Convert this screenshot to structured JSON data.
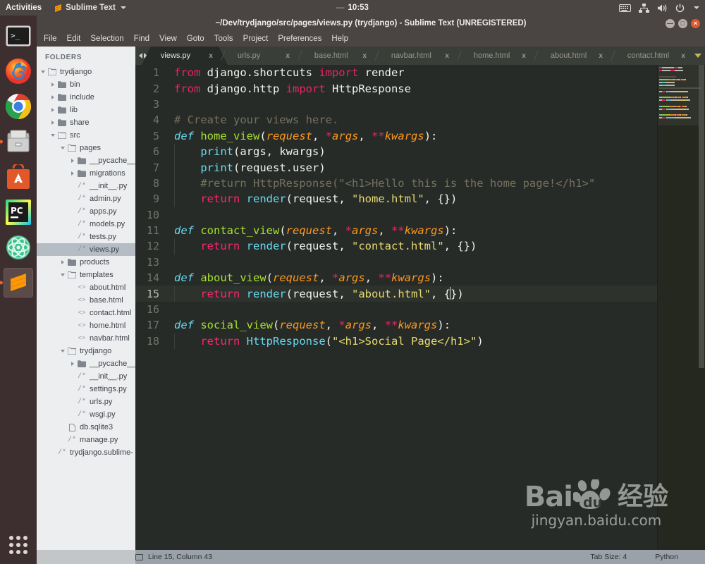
{
  "topbar": {
    "activities": "Activities",
    "app_name": "Sublime Text",
    "clock": "10:53",
    "clock_dash": "—",
    "icons": [
      "keyboard-icon",
      "network-icon",
      "volume-icon",
      "power-icon",
      "chevron-down-icon"
    ]
  },
  "launcher": {
    "items": [
      {
        "name": "terminal",
        "label": "Terminal",
        "active": false
      },
      {
        "name": "firefox",
        "label": "Firefox",
        "active": false
      },
      {
        "name": "chrome",
        "label": "Google Chrome",
        "active": false
      },
      {
        "name": "files",
        "label": "Files",
        "active": false,
        "running": true
      },
      {
        "name": "ubuntu-software",
        "label": "Ubuntu Software",
        "active": false
      },
      {
        "name": "pycharm",
        "label": "PyCharm",
        "active": false
      },
      {
        "name": "atom",
        "label": "Atom",
        "active": false
      },
      {
        "name": "sublime-text",
        "label": "Sublime Text",
        "active": true,
        "running": true
      }
    ],
    "app_grid": "show-applications"
  },
  "window": {
    "title": "~/Dev/trydjango/src/pages/views.py (trydjango) - Sublime Text (UNREGISTERED)",
    "buttons": {
      "minimize": "—",
      "maximize": "□",
      "close": "×"
    }
  },
  "menubar": {
    "items": [
      "File",
      "Edit",
      "Selection",
      "Find",
      "View",
      "Goto",
      "Tools",
      "Project",
      "Preferences",
      "Help"
    ]
  },
  "sidebar": {
    "title": "FOLDERS",
    "tree": [
      {
        "label": "trydjango",
        "depth": 0,
        "type": "folder-open",
        "twisty": "open",
        "selected": false
      },
      {
        "label": "bin",
        "depth": 1,
        "type": "folder",
        "twisty": "closed",
        "selected": false
      },
      {
        "label": "include",
        "depth": 1,
        "type": "folder",
        "twisty": "closed",
        "selected": false
      },
      {
        "label": "lib",
        "depth": 1,
        "type": "folder",
        "twisty": "closed",
        "selected": false
      },
      {
        "label": "share",
        "depth": 1,
        "type": "folder",
        "twisty": "closed",
        "selected": false
      },
      {
        "label": "src",
        "depth": 1,
        "type": "folder-open",
        "twisty": "open",
        "selected": false
      },
      {
        "label": "pages",
        "depth": 2,
        "type": "folder-open",
        "twisty": "open",
        "selected": false
      },
      {
        "label": "__pycache__",
        "depth": 3,
        "type": "folder",
        "twisty": "closed",
        "selected": false
      },
      {
        "label": "migrations",
        "depth": 3,
        "type": "folder",
        "twisty": "closed",
        "selected": false
      },
      {
        "label": "__init__.py",
        "depth": 3,
        "type": "py",
        "twisty": "none",
        "selected": false
      },
      {
        "label": "admin.py",
        "depth": 3,
        "type": "py",
        "twisty": "none",
        "selected": false
      },
      {
        "label": "apps.py",
        "depth": 3,
        "type": "py",
        "twisty": "none",
        "selected": false
      },
      {
        "label": "models.py",
        "depth": 3,
        "type": "py",
        "twisty": "none",
        "selected": false
      },
      {
        "label": "tests.py",
        "depth": 3,
        "type": "py",
        "twisty": "none",
        "selected": false
      },
      {
        "label": "views.py",
        "depth": 3,
        "type": "py",
        "twisty": "none",
        "selected": true
      },
      {
        "label": "products",
        "depth": 2,
        "type": "folder",
        "twisty": "closed",
        "selected": false
      },
      {
        "label": "templates",
        "depth": 2,
        "type": "folder-open",
        "twisty": "open",
        "selected": false
      },
      {
        "label": "about.html",
        "depth": 3,
        "type": "html",
        "twisty": "none",
        "selected": false
      },
      {
        "label": "base.html",
        "depth": 3,
        "type": "html",
        "twisty": "none",
        "selected": false
      },
      {
        "label": "contact.html",
        "depth": 3,
        "type": "html",
        "twisty": "none",
        "selected": false
      },
      {
        "label": "home.html",
        "depth": 3,
        "type": "html",
        "twisty": "none",
        "selected": false
      },
      {
        "label": "navbar.html",
        "depth": 3,
        "type": "html",
        "twisty": "none",
        "selected": false
      },
      {
        "label": "trydjango",
        "depth": 2,
        "type": "folder-open",
        "twisty": "open",
        "selected": false
      },
      {
        "label": "__pycache__",
        "depth": 3,
        "type": "folder",
        "twisty": "closed",
        "selected": false
      },
      {
        "label": "__init__.py",
        "depth": 3,
        "type": "py",
        "twisty": "none",
        "selected": false
      },
      {
        "label": "settings.py",
        "depth": 3,
        "type": "py",
        "twisty": "none",
        "selected": false
      },
      {
        "label": "urls.py",
        "depth": 3,
        "type": "py",
        "twisty": "none",
        "selected": false
      },
      {
        "label": "wsgi.py",
        "depth": 3,
        "type": "py",
        "twisty": "none",
        "selected": false
      },
      {
        "label": "db.sqlite3",
        "depth": 2,
        "type": "file",
        "twisty": "none",
        "selected": false
      },
      {
        "label": "manage.py",
        "depth": 2,
        "type": "py",
        "twisty": "none",
        "selected": false
      },
      {
        "label": "trydjango.sublime-",
        "depth": 1,
        "type": "py",
        "twisty": "none",
        "selected": false
      }
    ]
  },
  "tabs": {
    "close_glyph": "x",
    "items": [
      {
        "label": "views.py",
        "active": true
      },
      {
        "label": "urls.py",
        "active": false
      },
      {
        "label": "base.html",
        "active": false
      },
      {
        "label": "navbar.html",
        "active": false
      },
      {
        "label": "home.html",
        "active": false
      },
      {
        "label": "about.html",
        "active": false
      },
      {
        "label": "contact.html",
        "active": false
      }
    ]
  },
  "editor": {
    "language": "Python",
    "lines": [
      {
        "n": "1",
        "cur": false,
        "tokens": [
          {
            "t": "from",
            "c": "kw"
          },
          {
            "t": " django.shortcuts ",
            "c": "id"
          },
          {
            "t": "import",
            "c": "kw"
          },
          {
            "t": " render",
            "c": "id"
          }
        ]
      },
      {
        "n": "2",
        "cur": false,
        "tokens": [
          {
            "t": "from",
            "c": "kw"
          },
          {
            "t": " django.http ",
            "c": "id"
          },
          {
            "t": "import",
            "c": "kw"
          },
          {
            "t": " HttpResponse",
            "c": "id"
          }
        ]
      },
      {
        "n": "3",
        "cur": false,
        "tokens": []
      },
      {
        "n": "4",
        "cur": false,
        "tokens": [
          {
            "t": "# Create your views here.",
            "c": "cmt"
          }
        ]
      },
      {
        "n": "5",
        "cur": false,
        "tokens": [
          {
            "t": "def",
            "c": "defkw"
          },
          {
            "t": " ",
            "c": "id"
          },
          {
            "t": "home_view",
            "c": "fn"
          },
          {
            "t": "(",
            "c": "op"
          },
          {
            "t": "request",
            "c": "par"
          },
          {
            "t": ", ",
            "c": "op"
          },
          {
            "t": "*",
            "c": "kw"
          },
          {
            "t": "args",
            "c": "par"
          },
          {
            "t": ", ",
            "c": "op"
          },
          {
            "t": "**",
            "c": "kw"
          },
          {
            "t": "kwargs",
            "c": "par"
          },
          {
            "t": "):",
            "c": "op"
          }
        ]
      },
      {
        "n": "6",
        "cur": false,
        "tokens": [
          {
            "t": "    ",
            "c": "op"
          },
          {
            "t": "print",
            "c": "call"
          },
          {
            "t": "(args, kwargs)",
            "c": "id"
          }
        ]
      },
      {
        "n": "7",
        "cur": false,
        "tokens": [
          {
            "t": "    ",
            "c": "op"
          },
          {
            "t": "print",
            "c": "call"
          },
          {
            "t": "(request.user)",
            "c": "id"
          }
        ]
      },
      {
        "n": "8",
        "cur": false,
        "tokens": [
          {
            "t": "    #return HttpResponse(\"<h1>Hello this is the home page!</h1>\"",
            "c": "cmt"
          }
        ]
      },
      {
        "n": "9",
        "cur": false,
        "tokens": [
          {
            "t": "    ",
            "c": "op"
          },
          {
            "t": "return",
            "c": "kw2"
          },
          {
            "t": " ",
            "c": "id"
          },
          {
            "t": "render",
            "c": "call"
          },
          {
            "t": "(request, ",
            "c": "id"
          },
          {
            "t": "\"home.html\"",
            "c": "str"
          },
          {
            "t": ", {})",
            "c": "id"
          }
        ]
      },
      {
        "n": "10",
        "cur": false,
        "tokens": []
      },
      {
        "n": "11",
        "cur": false,
        "tokens": [
          {
            "t": "def",
            "c": "defkw"
          },
          {
            "t": " ",
            "c": "id"
          },
          {
            "t": "contact_view",
            "c": "fn"
          },
          {
            "t": "(",
            "c": "op"
          },
          {
            "t": "request",
            "c": "par"
          },
          {
            "t": ", ",
            "c": "op"
          },
          {
            "t": "*",
            "c": "kw"
          },
          {
            "t": "args",
            "c": "par"
          },
          {
            "t": ", ",
            "c": "op"
          },
          {
            "t": "**",
            "c": "kw"
          },
          {
            "t": "kwargs",
            "c": "par"
          },
          {
            "t": "):",
            "c": "op"
          }
        ]
      },
      {
        "n": "12",
        "cur": false,
        "tokens": [
          {
            "t": "    ",
            "c": "op"
          },
          {
            "t": "return",
            "c": "kw2"
          },
          {
            "t": " ",
            "c": "id"
          },
          {
            "t": "render",
            "c": "call"
          },
          {
            "t": "(request, ",
            "c": "id"
          },
          {
            "t": "\"contact.html\"",
            "c": "str"
          },
          {
            "t": ", {})",
            "c": "id"
          }
        ]
      },
      {
        "n": "13",
        "cur": false,
        "tokens": []
      },
      {
        "n": "14",
        "cur": false,
        "tokens": [
          {
            "t": "def",
            "c": "defkw"
          },
          {
            "t": " ",
            "c": "id"
          },
          {
            "t": "about_view",
            "c": "fn"
          },
          {
            "t": "(",
            "c": "op"
          },
          {
            "t": "request",
            "c": "par"
          },
          {
            "t": ", ",
            "c": "op"
          },
          {
            "t": "*",
            "c": "kw"
          },
          {
            "t": "args",
            "c": "par"
          },
          {
            "t": ", ",
            "c": "op"
          },
          {
            "t": "**",
            "c": "kw"
          },
          {
            "t": "kwargs",
            "c": "par"
          },
          {
            "t": "):",
            "c": "op"
          }
        ]
      },
      {
        "n": "15",
        "cur": true,
        "tokens": [
          {
            "t": "    ",
            "c": "op"
          },
          {
            "t": "return",
            "c": "kw2"
          },
          {
            "t": " ",
            "c": "id"
          },
          {
            "t": "render",
            "c": "call"
          },
          {
            "t": "(request, ",
            "c": "id"
          },
          {
            "t": "\"about.html\"",
            "c": "str"
          },
          {
            "t": ", {",
            "c": "id"
          },
          {
            "t": "",
            "c": "caret"
          },
          {
            "t": "})",
            "c": "id"
          }
        ]
      },
      {
        "n": "16",
        "cur": false,
        "tokens": []
      },
      {
        "n": "17",
        "cur": false,
        "tokens": [
          {
            "t": "def",
            "c": "defkw"
          },
          {
            "t": " ",
            "c": "id"
          },
          {
            "t": "social_view",
            "c": "fn"
          },
          {
            "t": "(",
            "c": "op"
          },
          {
            "t": "request",
            "c": "par"
          },
          {
            "t": ", ",
            "c": "op"
          },
          {
            "t": "*",
            "c": "kw"
          },
          {
            "t": "args",
            "c": "par"
          },
          {
            "t": ", ",
            "c": "op"
          },
          {
            "t": "**",
            "c": "kw"
          },
          {
            "t": "kwargs",
            "c": "par"
          },
          {
            "t": "):",
            "c": "op"
          }
        ]
      },
      {
        "n": "18",
        "cur": false,
        "tokens": [
          {
            "t": "    ",
            "c": "op"
          },
          {
            "t": "return",
            "c": "kw2"
          },
          {
            "t": " ",
            "c": "id"
          },
          {
            "t": "HttpResponse",
            "c": "call"
          },
          {
            "t": "(",
            "c": "id"
          },
          {
            "t": "\"<h1>Social Page</h1>\"",
            "c": "str"
          },
          {
            "t": ")",
            "c": "id"
          }
        ]
      }
    ]
  },
  "statusbar": {
    "position": "Line 15, Column 43",
    "tab_size": "Tab Size: 4",
    "syntax": "Python"
  },
  "watermark": {
    "brand": "Baidu",
    "brand_left": "Bai",
    "brand_right": "du",
    "chinese": "经验",
    "url": "jingyan.baidu.com"
  },
  "colors": {
    "accent_orange": "#e8622a",
    "keyword_pink": "#f92672",
    "function_green": "#a6e22e",
    "type_cyan": "#66d9ef",
    "string_yellow": "#e6db74",
    "comment_grey": "#75715e",
    "param_orange": "#fd971f",
    "editor_bg": "#272b27",
    "sidebar_bg": "#edeef0"
  }
}
